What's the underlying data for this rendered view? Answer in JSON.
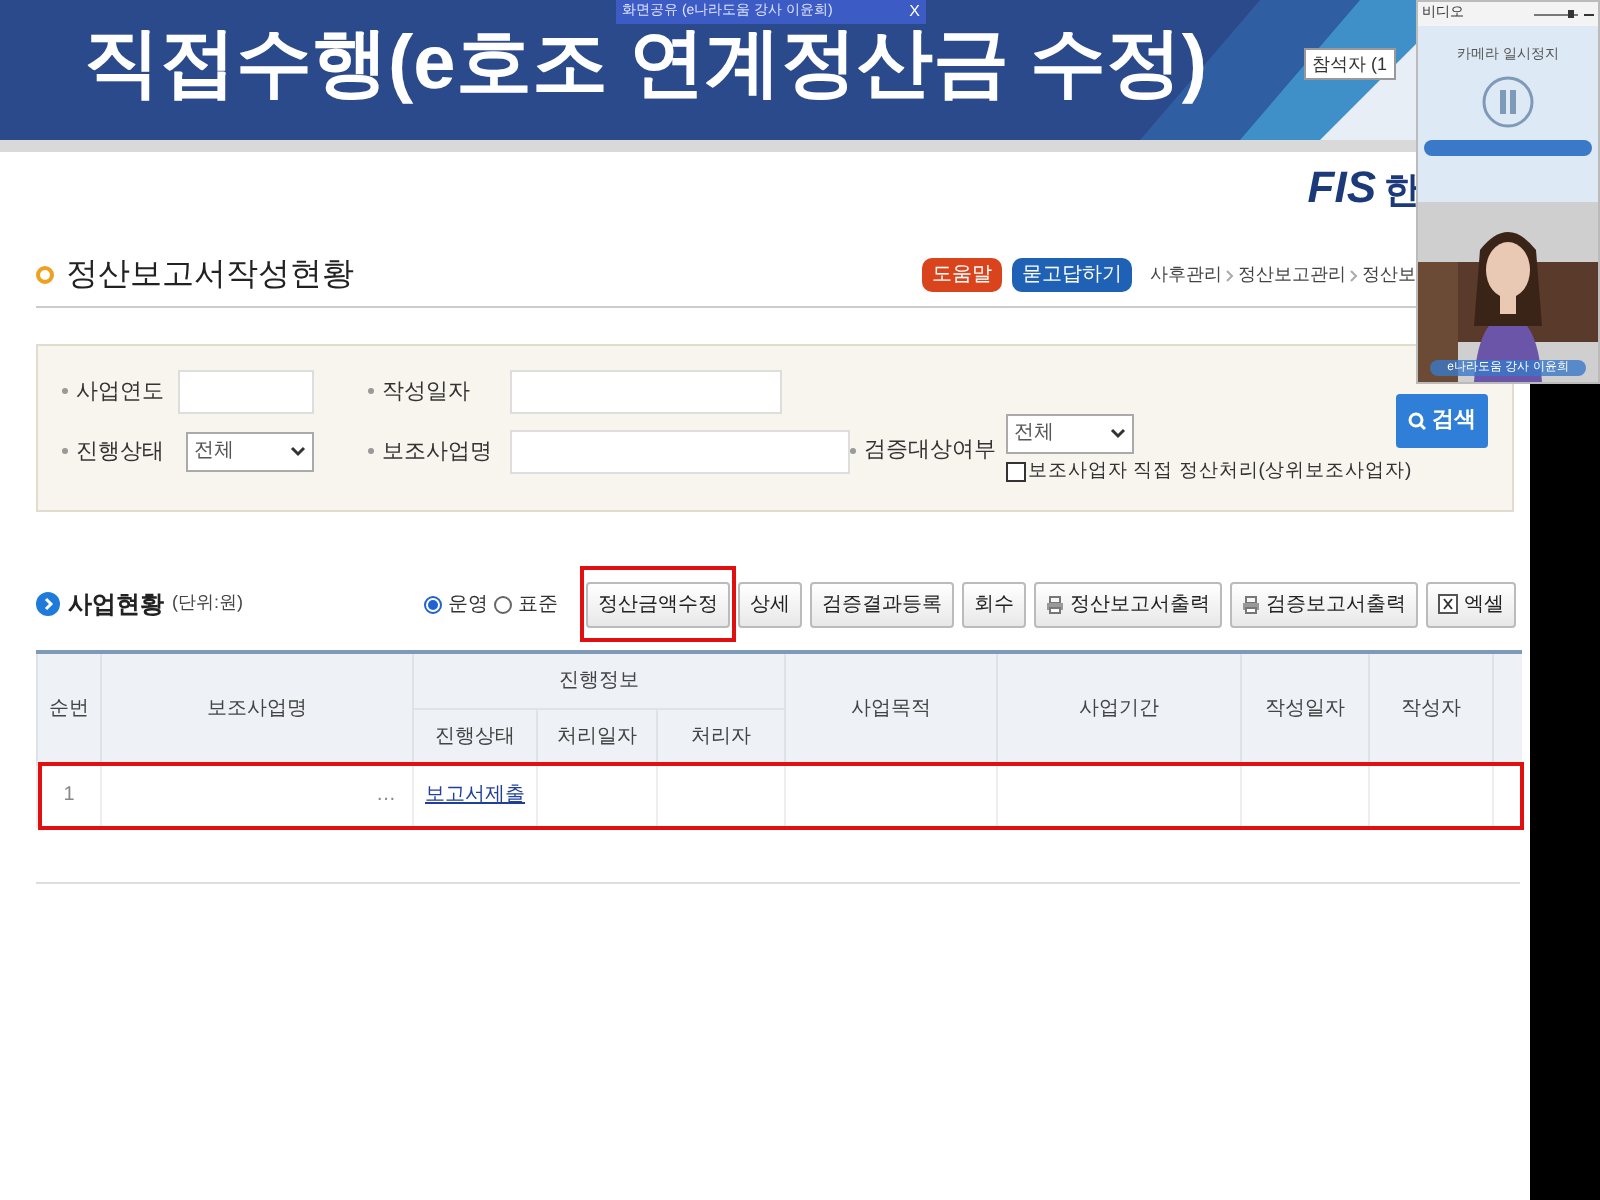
{
  "share_bar": {
    "text": "화면공유 (e나라도움 강사 이윤희)",
    "close": "X"
  },
  "banner": {
    "title": "직접수행(e호조 연계정산금 수정)",
    "attendee_tab": "참석자 (1"
  },
  "video_panel": {
    "title": "비디오",
    "volume": {
      "level": 0.9
    },
    "camera_status": "카메라 일시정지",
    "webcam_label": "e나라도움 강사 이윤희"
  },
  "logo": {
    "text": "FIS",
    "suffix": "한"
  },
  "page": {
    "title": "정산보고서작성현황",
    "help_button": "도움말",
    "qna_button": "묻고답하기",
    "breadcrumb": [
      "사후관리",
      "정산보고관리",
      "정산보"
    ]
  },
  "search": {
    "rows": [
      [
        {
          "label": "사업연도",
          "kind": "text"
        },
        {
          "label": "작성일자",
          "kind": "text"
        }
      ],
      [
        {
          "label": "진행상태",
          "kind": "select",
          "value": "전체"
        },
        {
          "label": "보조사업명",
          "kind": "text"
        },
        {
          "label": "검증대상여부",
          "kind": "select",
          "value": "전체"
        }
      ]
    ],
    "checkbox": {
      "label": "보조사업자 직접 정산처리(상위보조사업자)",
      "checked": false
    },
    "button": "검색"
  },
  "section": {
    "title": "사업현황",
    "unit": "(단위:원)",
    "radios": [
      {
        "label": "운영",
        "selected": true
      },
      {
        "label": "표준",
        "selected": false
      }
    ],
    "buttons": [
      {
        "label": "정산금액수정",
        "kind": "plain",
        "highlighted": true
      },
      {
        "label": "상세",
        "kind": "plain"
      },
      {
        "label": "검증결과등록",
        "kind": "plain"
      },
      {
        "label": "회수",
        "kind": "plain"
      },
      {
        "label": "정산보고서출력",
        "kind": "print"
      },
      {
        "label": "검증보고서출력",
        "kind": "print"
      },
      {
        "label": "엑셀",
        "kind": "export"
      }
    ]
  },
  "table": {
    "columns": [
      "순번",
      "보조사업명",
      "진행정보",
      "사업목적",
      "사업기간",
      "작성일자",
      "작성자"
    ],
    "sub_columns": [
      "진행상태",
      "처리일자",
      "처리자"
    ],
    "rows": [
      {
        "no": "1",
        "name": "…",
        "status": "보고서제출",
        "highlighted": true
      }
    ]
  }
}
